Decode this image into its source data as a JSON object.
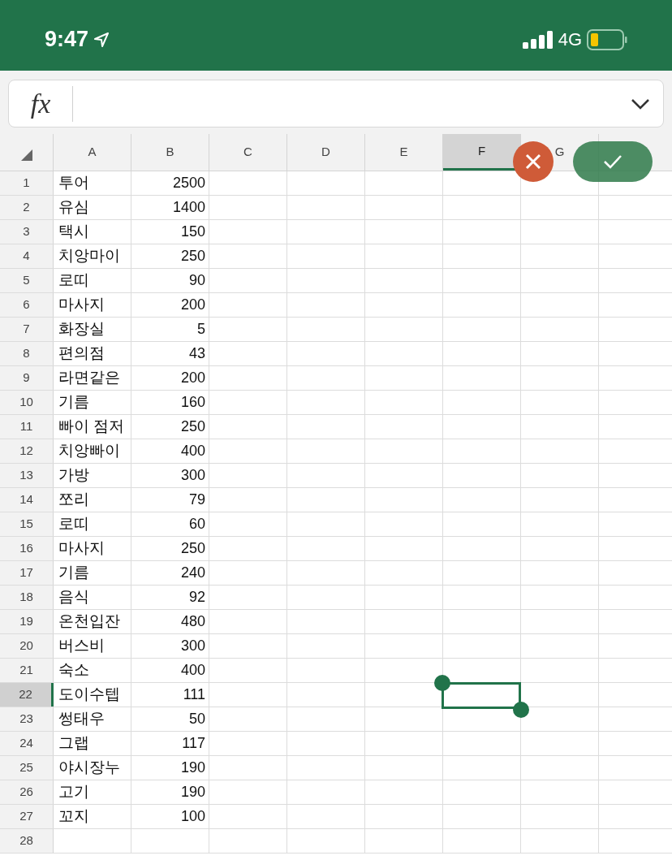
{
  "status_bar": {
    "time": "9:47",
    "network": "4G"
  },
  "formula_bar": {
    "label": "fx"
  },
  "columns": [
    {
      "label": "A",
      "selected": false
    },
    {
      "label": "B",
      "selected": false
    },
    {
      "label": "C",
      "selected": false
    },
    {
      "label": "D",
      "selected": false
    },
    {
      "label": "E",
      "selected": false
    },
    {
      "label": "F",
      "selected": true
    },
    {
      "label": "G",
      "selected": false
    }
  ],
  "rows": [
    {
      "number": "1",
      "a": "투어",
      "b": "2500",
      "selected": false
    },
    {
      "number": "2",
      "a": "유심",
      "b": "1400",
      "selected": false
    },
    {
      "number": "3",
      "a": "택시",
      "b": "150",
      "selected": false
    },
    {
      "number": "4",
      "a": "치앙마이",
      "b": "250",
      "selected": false
    },
    {
      "number": "5",
      "a": "로띠",
      "b": "90",
      "selected": false
    },
    {
      "number": "6",
      "a": "마사지",
      "b": "200",
      "selected": false
    },
    {
      "number": "7",
      "a": "화장실",
      "b": "5",
      "selected": false
    },
    {
      "number": "8",
      "a": "편의점",
      "b": "43",
      "selected": false
    },
    {
      "number": "9",
      "a": "라면같은",
      "b": "200",
      "selected": false
    },
    {
      "number": "10",
      "a": "기름",
      "b": "160",
      "selected": false
    },
    {
      "number": "11",
      "a": "빠이 점저",
      "b": "250",
      "selected": false
    },
    {
      "number": "12",
      "a": "치앙빠이",
      "b": "400",
      "selected": false
    },
    {
      "number": "13",
      "a": "가방",
      "b": "300",
      "selected": false
    },
    {
      "number": "14",
      "a": "쪼리",
      "b": "79",
      "selected": false
    },
    {
      "number": "15",
      "a": "로띠",
      "b": "60",
      "selected": false
    },
    {
      "number": "16",
      "a": "마사지",
      "b": "250",
      "selected": false
    },
    {
      "number": "17",
      "a": "기름",
      "b": "240",
      "selected": false
    },
    {
      "number": "18",
      "a": "음식",
      "b": "92",
      "selected": false
    },
    {
      "number": "19",
      "a": "온천입잔",
      "b": "480",
      "selected": false
    },
    {
      "number": "20",
      "a": "버스비",
      "b": "300",
      "selected": false
    },
    {
      "number": "21",
      "a": "숙소",
      "b": "400",
      "selected": false
    },
    {
      "number": "22",
      "a": "도이수텝",
      "b": "111",
      "selected": true
    },
    {
      "number": "23",
      "a": "썽태우",
      "b": "50",
      "selected": false
    },
    {
      "number": "24",
      "a": "그랩",
      "b": "117",
      "selected": false
    },
    {
      "number": "25",
      "a": "야시장누",
      "b": "190",
      "selected": false
    },
    {
      "number": "26",
      "a": "고기",
      "b": "190",
      "selected": false
    },
    {
      "number": "27",
      "a": "꼬지",
      "b": "100",
      "selected": false
    },
    {
      "number": "28",
      "selected": false
    }
  ]
}
